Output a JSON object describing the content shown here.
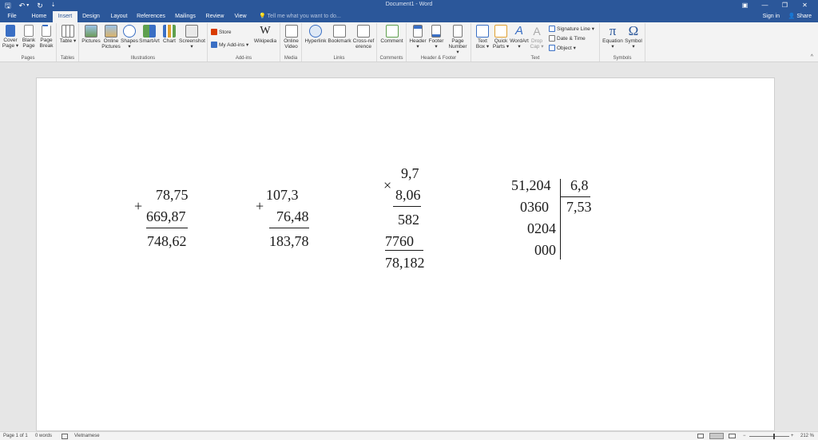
{
  "window": {
    "title": "Document1 - Word"
  },
  "quick_access": {
    "icons": [
      "save-icon",
      "undo-icon",
      "redo-icon",
      "customize-qat-icon"
    ],
    "save": "🖫",
    "undo": "↶",
    "undo_dd": "▾",
    "redo": "↻",
    "customize": "⇣"
  },
  "window_controls": {
    "ribbon_display": "▣",
    "minimize": "—",
    "restore": "❐",
    "close": "✕"
  },
  "tabs": [
    {
      "label": "File"
    },
    {
      "label": "Home"
    },
    {
      "label": "Insert",
      "active": true
    },
    {
      "label": "Design"
    },
    {
      "label": "Layout"
    },
    {
      "label": "References"
    },
    {
      "label": "Mailings"
    },
    {
      "label": "Review"
    },
    {
      "label": "View"
    }
  ],
  "tell_me": "Tell me what you want to do...",
  "tell_me_icon": "💡",
  "account": {
    "sign_in": "Sign in",
    "share": "Share",
    "share_icon": "👤"
  },
  "ribbon": {
    "groups": {
      "pages": "Pages",
      "tables": "Tables",
      "illustrations": "Illustrations",
      "addins": "Add-ins",
      "media": "Media",
      "links": "Links",
      "comments": "Comments",
      "header_footer": "Header & Footer",
      "text": "Text",
      "symbols": "Symbols"
    },
    "buttons": {
      "cover_page": "Cover Page ▾",
      "blank_page": "Blank Page",
      "page_break": "Page Break",
      "table": "Table ▾",
      "pictures": "Pictures",
      "online_pictures": "Online Pictures",
      "shapes": "Shapes ▾",
      "smartart": "SmartArt",
      "chart": "Chart",
      "screenshot": "Screenshot ▾",
      "store": "Store",
      "my_addins": "My Add-ins",
      "my_addins_dd": "▾",
      "wikipedia": "Wikipedia",
      "online_video": "Online Video",
      "hyperlink": "Hyperlink",
      "bookmark": "Bookmark",
      "cross_reference": "Cross-reference",
      "comment": "Comment",
      "header": "Header ▾",
      "footer": "Footer ▾",
      "page_number": "Page Number ▾",
      "text_box": "Text Box ▾",
      "quick_parts": "Quick Parts ▾",
      "wordart": "WordArt ▾",
      "drop_cap": "Drop Cap ▾",
      "signature_line": "Signature Line",
      "signature_line_dd": "▾",
      "date_time": "Date & Time",
      "object": "Object",
      "object_dd": "▾",
      "equation": "Equation ▾",
      "symbol": "Symbol ▾"
    },
    "glyphs": {
      "wikipedia": "W",
      "equation": "π",
      "symbol": "Ω",
      "wordart": "A",
      "drop_cap": "A"
    },
    "collapse": "^"
  },
  "document": {
    "addition1": {
      "top": "78,75",
      "sign": "+",
      "bottom": "669,87",
      "result": "748,62"
    },
    "addition2": {
      "top": "107,3",
      "sign": "+",
      "bottom": "76,48",
      "result": "183,78"
    },
    "multiplication": {
      "top": "9,7",
      "sign": "×",
      "bottom": "8,06",
      "partial1": "582",
      "partial2": "7760",
      "result": "78,182"
    },
    "division": {
      "dividend": "51,204",
      "divisor": "6,8",
      "rem1": "0360",
      "quotient": "7,53",
      "rem2": "0204",
      "rem3": "000"
    }
  },
  "status": {
    "page": "Page 1 of 1",
    "words": "0 words",
    "proofing_icon": "proofing-icon",
    "language": "Vietnamese",
    "zoom": "212 %",
    "zoom_minus": "−",
    "zoom_plus": "+"
  },
  "colors": {
    "brand": "#2b579a",
    "ribbon_bg": "#f3f3f3",
    "canvas_bg": "#e6e6e6"
  }
}
